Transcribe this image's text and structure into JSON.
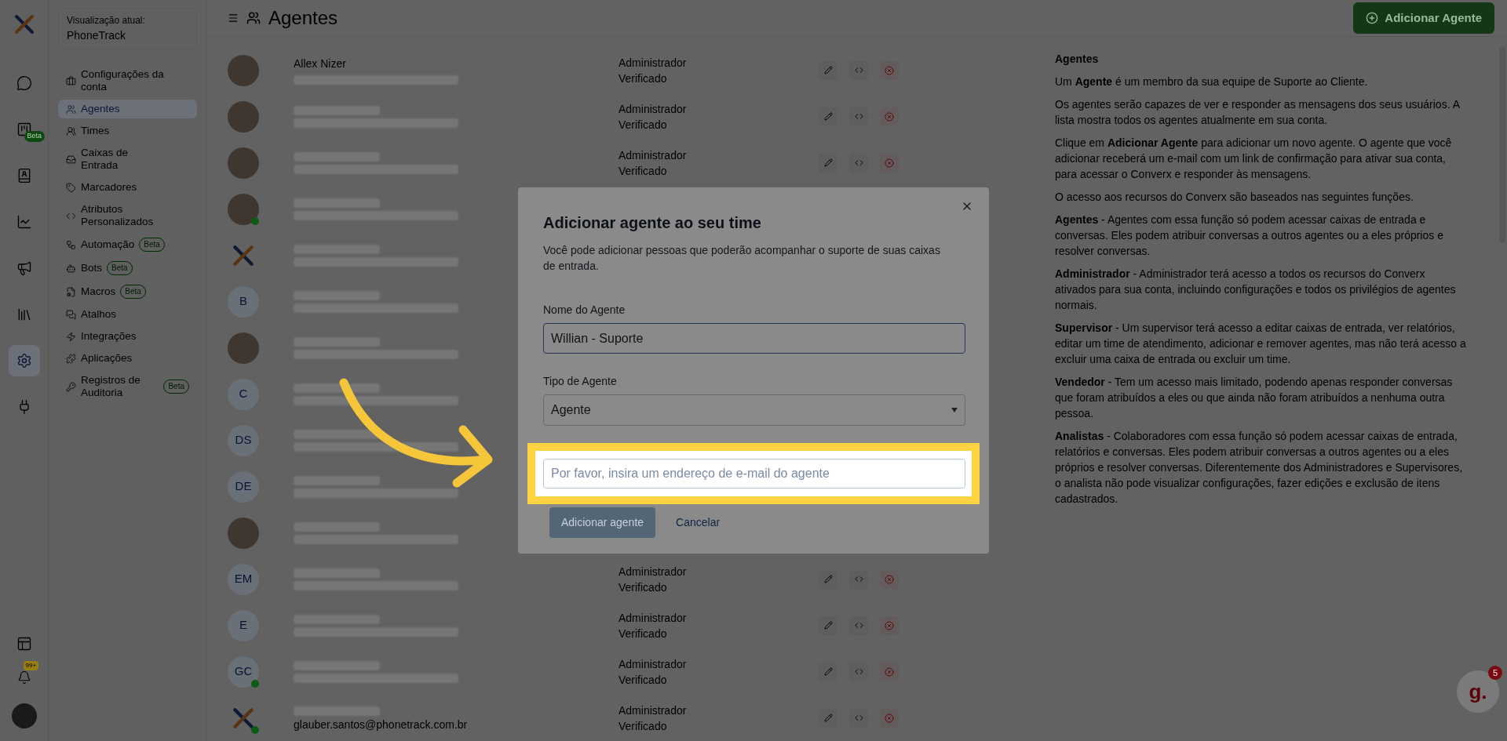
{
  "rail": {
    "items": [
      {
        "kind": "chat",
        "selected": false
      },
      {
        "kind": "board",
        "selected": false,
        "badge": "Beta"
      },
      {
        "kind": "contacts",
        "selected": false
      },
      {
        "kind": "reports",
        "selected": false
      },
      {
        "kind": "campaigns",
        "selected": false
      },
      {
        "kind": "library",
        "selected": false
      },
      {
        "kind": "settings",
        "selected": true
      },
      {
        "kind": "integrations",
        "selected": false
      }
    ],
    "bottom": {
      "notifications_badge": "99+"
    }
  },
  "sidebar": {
    "context_label": "Visualização atual:",
    "account": "PhoneTrack",
    "items": [
      {
        "kind": "briefcase",
        "label": "Configurações da conta",
        "selected": false
      },
      {
        "kind": "users",
        "label": "Agentes",
        "selected": true
      },
      {
        "kind": "team",
        "label": "Times",
        "selected": false
      },
      {
        "kind": "inbox",
        "label": "Caixas de Entrada",
        "selected": false
      },
      {
        "kind": "tag",
        "label": "Marcadores",
        "selected": false
      },
      {
        "kind": "code",
        "label": "Atributos Personalizados",
        "selected": false
      },
      {
        "kind": "automation",
        "label": "Automação",
        "selected": false,
        "badge": "Beta"
      },
      {
        "kind": "bot",
        "label": "Bots",
        "selected": false,
        "badge": "Beta"
      },
      {
        "kind": "macro",
        "label": "Macros",
        "selected": false,
        "badge": "Beta"
      },
      {
        "kind": "chats",
        "label": "Atalhos",
        "selected": false
      },
      {
        "kind": "bolt",
        "label": "Integrações",
        "selected": false
      },
      {
        "kind": "apps",
        "label": "Aplicações",
        "selected": false
      },
      {
        "kind": "key",
        "label": "Registros de Auditoria",
        "selected": false,
        "badge": "Beta"
      }
    ]
  },
  "header": {
    "title": "Agentes",
    "add_button": "Adicionar Agente"
  },
  "agents": [
    {
      "avatar": {
        "kind": "photo"
      },
      "online": false,
      "name": "Allex Nizer",
      "role": "Administrador",
      "status": "Verificado"
    },
    {
      "avatar": {
        "kind": "photo"
      },
      "online": false,
      "role": "Administrador",
      "status": "Verificado"
    },
    {
      "avatar": {
        "kind": "photo"
      },
      "online": false,
      "role": "Administrador",
      "status": "Verificado"
    },
    {
      "avatar": {
        "kind": "photo"
      },
      "online": true
    },
    {
      "avatar": {
        "kind": "logo"
      },
      "online": false
    },
    {
      "avatar": {
        "kind": "initials",
        "text": "B"
      },
      "online": false
    },
    {
      "avatar": {
        "kind": "photo"
      },
      "online": false
    },
    {
      "avatar": {
        "kind": "initials",
        "text": "C"
      },
      "online": false
    },
    {
      "avatar": {
        "kind": "initials",
        "text": "DS"
      },
      "online": false
    },
    {
      "avatar": {
        "kind": "initials",
        "text": "DE"
      },
      "online": false
    },
    {
      "avatar": {
        "kind": "photo"
      },
      "online": false
    },
    {
      "avatar": {
        "kind": "initials",
        "text": "EM"
      },
      "online": false,
      "role": "Administrador",
      "status": "Verificado"
    },
    {
      "avatar": {
        "kind": "initials",
        "text": "E"
      },
      "online": false,
      "role": "Administrador",
      "status": "Verificado"
    },
    {
      "avatar": {
        "kind": "initials",
        "text": "GC"
      },
      "online": true,
      "role": "Administrador",
      "status": "Verificado"
    },
    {
      "avatar": {
        "kind": "logo"
      },
      "online": true,
      "email": "glauber.santos@phonetrack.com.br",
      "role": "Administrador",
      "status": "Verificado"
    }
  ],
  "help": {
    "title": "Agentes",
    "paragraphs": [
      "Um **Agente** é um membro da sua equipe de Suporte ao Cliente.",
      "Os agentes serão capazes de ver e responder as mensagens dos seus usuários. A lista mostra todos os agentes atualmente em sua conta.",
      "Clique em **Adicionar Agente** para adicionar um novo agente. O agente que você adicionar receberá um e-mail com um link de confirmação para ativar sua conta, para acessar o Converx e responder às mensagens.",
      "O acesso aos recursos do Converx são baseados nas seguintes funções.",
      "**Agentes** - Agentes com essa função só podem acessar caixas de entrada e conversas. Eles podem atribuir conversas a outros agentes ou a eles próprios e resolver conversas.",
      "**Administrador** - Administrador terá acesso a todos os recursos do Converx ativados para sua conta, incluindo configurações e todos os privilégios de agentes normais.",
      "**Supervisor** - Um supervisor terá acesso a editar caixas de entrada, ver relatórios, editar um time de atendimento, adicionar e remover agentes, mas não terá acesso a excluir uma caixa de entrada ou excluir um time.",
      "**Vendedor** - Tem um acesso mais limitado, podendo apenas responder conversas que foram atribuídos a eles ou que ainda não foram atribuídos a nenhuma outra pessoa.",
      "**Analistas** - Colaboradores com essa função só podem acessar caixas de entrada, relatórios e conversas. Eles podem atribuir conversas a outros agentes ou a eles próprios e resolver conversas. Diferentemente dos Administradores e Supervisores, o analista não pode visualizar configurações, fazer edições e exclusão de itens cadastrados."
    ]
  },
  "modal": {
    "title": "Adicionar agente ao seu time",
    "description": "Você pode adicionar pessoas que poderão acompanhar o suporte de suas caixas de entrada.",
    "name_label": "Nome do Agente",
    "name_value": "Willian - Suporte",
    "type_label": "Tipo de Agente",
    "type_value": "Agente",
    "email_placeholder": "Por favor, insira um endereço de e-mail do agente",
    "email_highlighted": true,
    "submit": "Adicionar agente",
    "submit_disabled": true,
    "cancel": "Cancelar"
  },
  "help_widget": {
    "logo": "g.",
    "badge": "5"
  }
}
